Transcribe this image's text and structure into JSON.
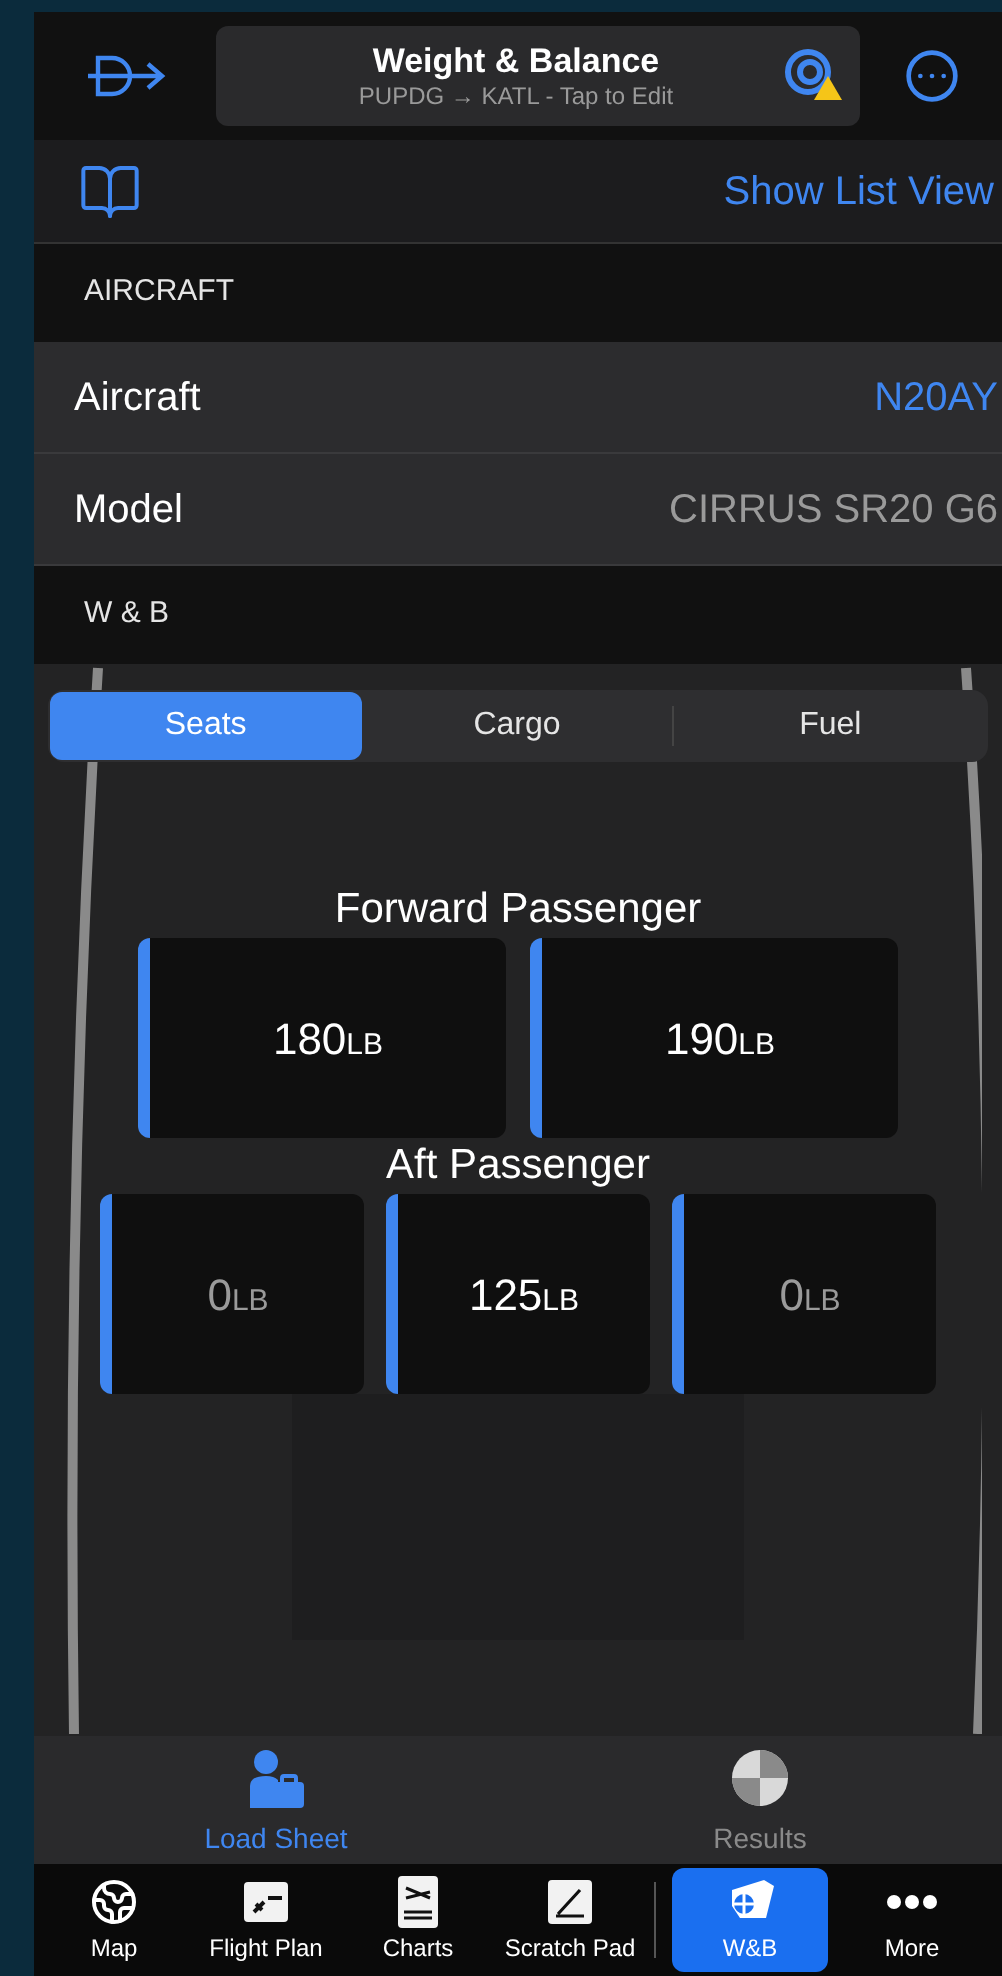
{
  "header": {
    "title": "Weight & Balance",
    "subtitle": "PUPDG → KATL - Tap to Edit",
    "warning": true
  },
  "toolbar": {
    "link": "Show List View"
  },
  "sections": [
    {
      "header": "AIRCRAFT",
      "rows": [
        {
          "label": "Aircraft",
          "value": "N20AY",
          "kind": "link"
        },
        {
          "label": "Model",
          "value": "CIRRUS SR20 G6",
          "kind": "plain"
        }
      ]
    },
    {
      "header": "W & B"
    }
  ],
  "segments": [
    {
      "label": "Seats",
      "selected": true
    },
    {
      "label": "Cargo",
      "selected": false
    },
    {
      "label": "Fuel",
      "selected": false
    }
  ],
  "seat_groups": [
    {
      "title": "Forward Passenger",
      "seats": [
        {
          "value": "180",
          "unit": "LB",
          "dimmed": false
        },
        {
          "value": "190",
          "unit": "LB",
          "dimmed": false
        }
      ]
    },
    {
      "title": "Aft Passenger",
      "seats": [
        {
          "value": "0",
          "unit": "LB",
          "dimmed": true
        },
        {
          "value": "125",
          "unit": "LB",
          "dimmed": false
        },
        {
          "value": "0",
          "unit": "LB",
          "dimmed": true
        }
      ]
    }
  ],
  "bottom_tabs": [
    {
      "label": "Load Sheet",
      "kind": "load",
      "selected": true
    },
    {
      "label": "Results",
      "kind": "results",
      "selected": false
    }
  ],
  "tab_bar": [
    {
      "label": "Map",
      "kind": "map",
      "selected": false
    },
    {
      "label": "Flight Plan",
      "kind": "plan",
      "selected": false
    },
    {
      "label": "Charts",
      "kind": "charts",
      "selected": false
    },
    {
      "label": "Scratch Pad",
      "kind": "pad",
      "selected": false
    },
    {
      "label": "W&B",
      "kind": "wb",
      "selected": true
    },
    {
      "label": "More",
      "kind": "more",
      "selected": false
    }
  ]
}
